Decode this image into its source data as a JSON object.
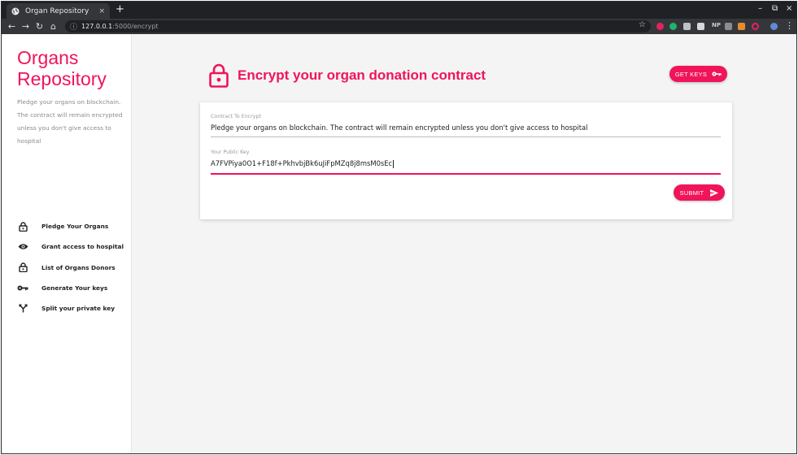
{
  "browser": {
    "tab_title": "Organ Repository",
    "tab_close": "×",
    "new_tab": "+",
    "url_host": "127.0.0.1",
    "url_path": ":5000/encrypt",
    "extension_np": "NP",
    "window_controls": [
      "–",
      "⧉",
      "×"
    ]
  },
  "sidebar": {
    "brand_line1": "Organs",
    "brand_line2": "Repository",
    "tagline": "Pledge your organs on blockchain. The contract will remain encrypted unless you don't give access to hospital",
    "items": [
      {
        "label": "Pledge Your Organs",
        "icon": "lock-icon"
      },
      {
        "label": "Grant access to hospital",
        "icon": "eye-icon"
      },
      {
        "label": "List of Organs Donors",
        "icon": "lock-icon"
      },
      {
        "label": "Generate Your keys",
        "icon": "key-icon"
      },
      {
        "label": "Split your private key",
        "icon": "split-icon"
      }
    ]
  },
  "main": {
    "title": "Encrypt your organ donation contract",
    "get_keys_label": "GET KEYS",
    "contract_label": "Contract To Encrypt",
    "contract_value": "Pledge your organs on blockchain. The contract will remain encrypted unless you don't give access to hospital",
    "pubkey_label": "Your Public Key",
    "pubkey_value": "A7FVPiya0O1+F18f+PkhvbjBk6uJiFpMZq8j8msM0sEc",
    "submit_label": "SUBMIT"
  },
  "colors": {
    "accent": "#f0145a",
    "main_bg": "#f4f4f4"
  }
}
